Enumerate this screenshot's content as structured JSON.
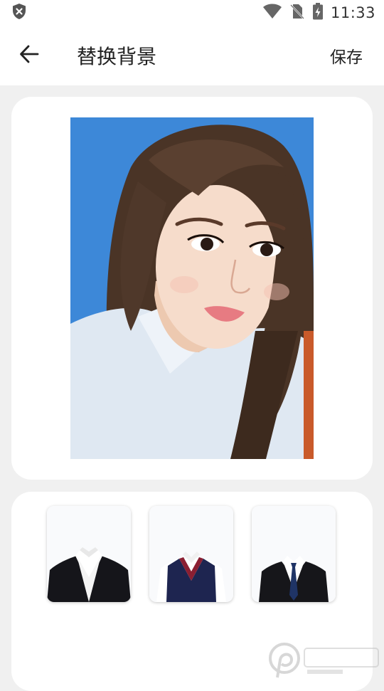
{
  "status_bar": {
    "time": "11:33",
    "icons": [
      "shield-x-icon",
      "wifi-icon",
      "no-sim-icon",
      "battery-charging-icon"
    ]
  },
  "app_bar": {
    "back_icon": "arrow-left-icon",
    "title": "替换背景",
    "save_label": "保存"
  },
  "photo": {
    "background_color": "#3d88d8",
    "description_icon": "portrait-photo"
  },
  "templates": [
    {
      "name": "black-suit-white-shirt"
    },
    {
      "name": "navy-sweater-vest"
    },
    {
      "name": "black-suit-blue-tie"
    }
  ],
  "watermark": {
    "logo": "watermark-logo-icon"
  },
  "colors": {
    "background": "#f0f0f0",
    "card": "#ffffff",
    "photo_bg": "#3d88d8"
  }
}
